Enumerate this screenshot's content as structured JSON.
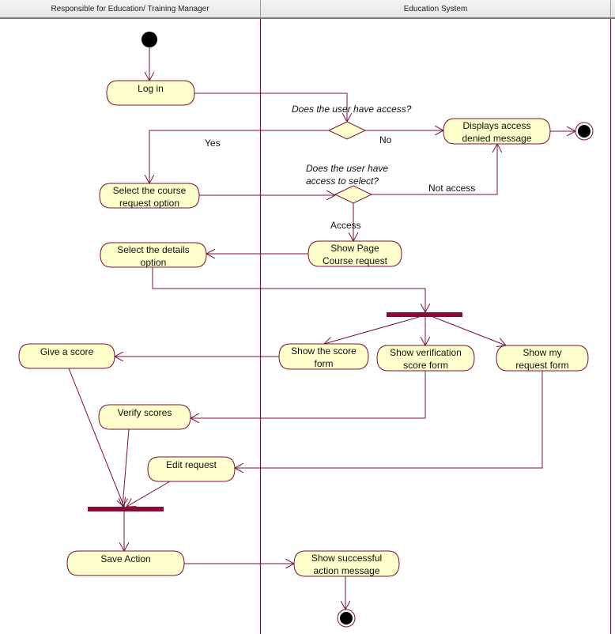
{
  "swimlanes": [
    {
      "id": "lane-manager",
      "title": "Responsible for Education/ Training Manager"
    },
    {
      "id": "lane-system",
      "title": "Education System"
    }
  ],
  "colors": {
    "line": "#7a1038",
    "activity_fill": "#ffffcc",
    "activity_stroke": "#7a1038",
    "bar": "#8b0a35",
    "node": "#000000",
    "lane_divider": "#7a1038"
  },
  "activities": {
    "log_in": [
      "Log in"
    ],
    "select_course_request": [
      "Select the course",
      "request option"
    ],
    "select_details": [
      "Select the details",
      "option"
    ],
    "give_score": [
      "Give a score"
    ],
    "verify_scores": [
      "Verify scores"
    ],
    "edit_request": [
      "Edit request"
    ],
    "save_action": [
      "Save Action"
    ],
    "displays_access_denied": [
      "Displays access",
      "denied message"
    ],
    "show_page_course_request": [
      "Show Page",
      "Course request"
    ],
    "show_score_form": [
      "Show the score",
      "form"
    ],
    "show_verification_score_form": [
      "Show verification",
      "score form"
    ],
    "show_my_request_form": [
      "Show my",
      "request form"
    ],
    "show_successful_action": [
      "Show successful",
      "action message"
    ]
  },
  "decisions": {
    "user_access": [
      "Does the user have access?"
    ],
    "user_access_select": [
      "Does the user have",
      "access to select?"
    ]
  },
  "guards": {
    "yes": "Yes",
    "no": "No",
    "not_access": "Not access",
    "access": "Access"
  }
}
